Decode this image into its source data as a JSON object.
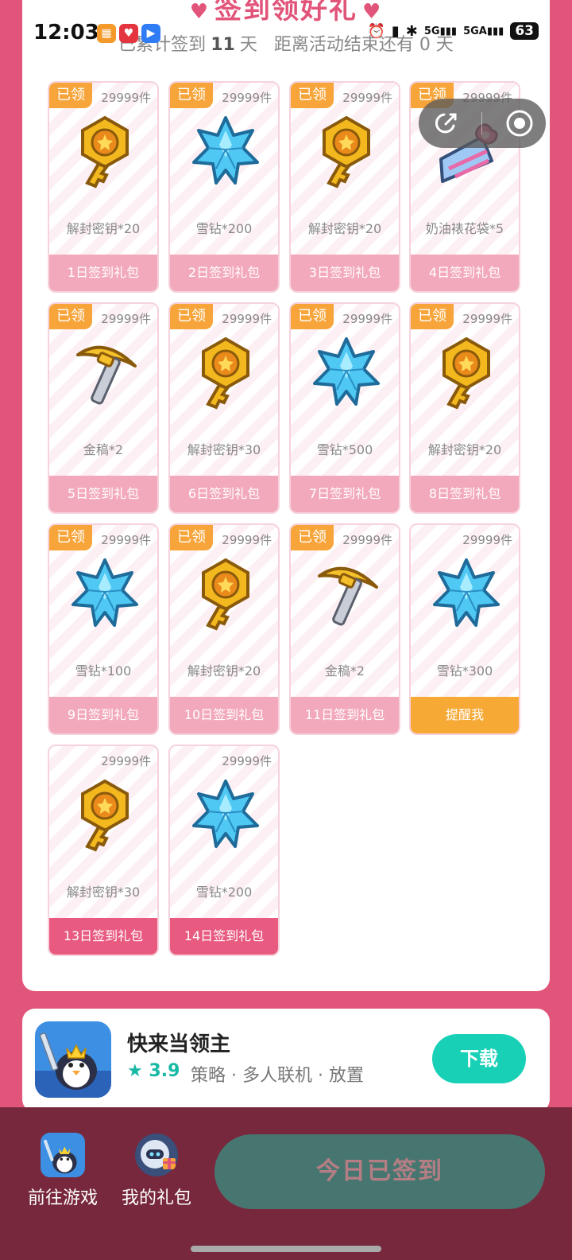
{
  "status_bar": {
    "time": "12:03",
    "network": "5G",
    "network2": "5GA",
    "battery": "63"
  },
  "header": {
    "title": "签到领好礼",
    "progress_prefix": "已累计签到",
    "signed_days": "11",
    "progress_unit": "天",
    "countdown_text": "距离活动结束还有 0 天"
  },
  "cards": [
    {
      "claimed": true,
      "badge": "已领",
      "stock": "29999件",
      "item_icon": "golden-key",
      "item_name": "解封密钥*20",
      "label": "1日签到礼包",
      "state": "claimed"
    },
    {
      "claimed": true,
      "badge": "已领",
      "stock": "29999件",
      "item_icon": "snow-diamond",
      "item_name": "雪钻*200",
      "label": "2日签到礼包",
      "state": "claimed"
    },
    {
      "claimed": true,
      "badge": "已领",
      "stock": "29999件",
      "item_icon": "golden-key",
      "item_name": "解封密钥*20",
      "label": "3日签到礼包",
      "state": "claimed"
    },
    {
      "claimed": true,
      "badge": "已领",
      "stock": "29999件",
      "item_icon": "cream-flower-bag",
      "item_name": "奶油裱花袋*5",
      "label": "4日签到礼包",
      "state": "claimed"
    },
    {
      "claimed": true,
      "badge": "已领",
      "stock": "29999件",
      "item_icon": "golden-pickaxe",
      "item_name": "金稿*2",
      "label": "5日签到礼包",
      "state": "claimed"
    },
    {
      "claimed": true,
      "badge": "已领",
      "stock": "29999件",
      "item_icon": "golden-key",
      "item_name": "解封密钥*30",
      "label": "6日签到礼包",
      "state": "claimed"
    },
    {
      "claimed": true,
      "badge": "已领",
      "stock": "29999件",
      "item_icon": "snow-diamond",
      "item_name": "雪钻*500",
      "label": "7日签到礼包",
      "state": "claimed"
    },
    {
      "claimed": true,
      "badge": "已领",
      "stock": "29999件",
      "item_icon": "golden-key",
      "item_name": "解封密钥*20",
      "label": "8日签到礼包",
      "state": "claimed"
    },
    {
      "claimed": true,
      "badge": "已领",
      "stock": "29999件",
      "item_icon": "snow-diamond",
      "item_name": "雪钻*100",
      "label": "9日签到礼包",
      "state": "claimed"
    },
    {
      "claimed": true,
      "badge": "已领",
      "stock": "29999件",
      "item_icon": "golden-key",
      "item_name": "解封密钥*20",
      "label": "10日签到礼包",
      "state": "claimed"
    },
    {
      "claimed": true,
      "badge": "已领",
      "stock": "29999件",
      "item_icon": "golden-pickaxe",
      "item_name": "金稿*2",
      "label": "11日签到礼包",
      "state": "claimed"
    },
    {
      "claimed": false,
      "badge": "",
      "stock": "29999件",
      "item_icon": "snow-diamond",
      "item_name": "雪钻*300",
      "label": "提醒我",
      "state": "remind"
    },
    {
      "claimed": false,
      "badge": "",
      "stock": "29999件",
      "item_icon": "golden-key",
      "item_name": "解封密钥*30",
      "label": "13日签到礼包",
      "state": "upcoming"
    },
    {
      "claimed": false,
      "badge": "",
      "stock": "29999件",
      "item_icon": "snow-diamond",
      "item_name": "雪钻*200",
      "label": "14日签到礼包",
      "state": "upcoming"
    }
  ],
  "game": {
    "name": "快来当领主",
    "rating": "3.9",
    "tags": "策略 · 多人联机 · 放置",
    "download_label": "下载"
  },
  "bottom_bar": {
    "goto_game_label": "前往游戏",
    "my_gifts_label": "我的礼包",
    "sign_button_label": "今日已签到"
  },
  "colors": {
    "primary_pink": "#e2557a",
    "accent_orange": "#f7a53a",
    "claimed_button": "#f3a9bc",
    "download_teal": "#17d0b6",
    "bottom_bar": "#77283c",
    "signed_button": "#477670"
  }
}
